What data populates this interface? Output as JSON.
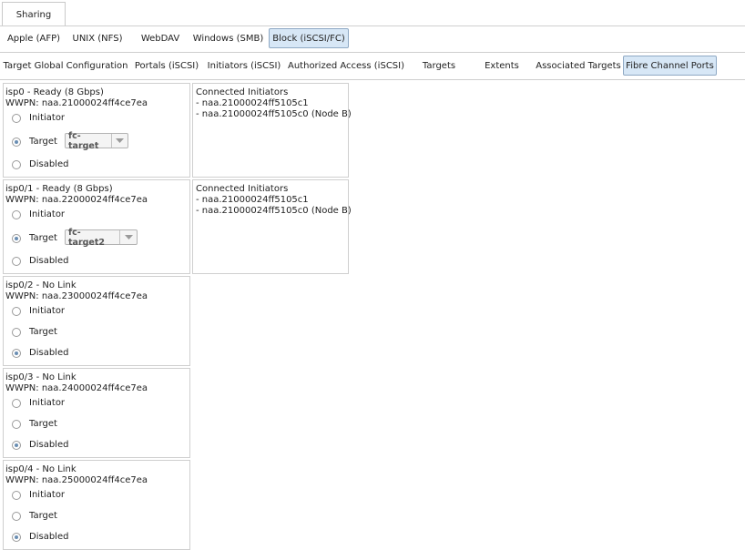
{
  "top_tab": "Sharing",
  "share_tabs": [
    "Apple (AFP)",
    "UNIX (NFS)",
    "WebDAV",
    "Windows (SMB)",
    "Block (iSCSI/FC)"
  ],
  "block_tabs": [
    "Target Global Configuration",
    "Portals (iSCSI)",
    "Initiators (iSCSI)",
    "Authorized Access (iSCSI)",
    "Targets",
    "Extents",
    "Associated Targets",
    "Fibre Channel Ports"
  ],
  "radio_labels": {
    "initiator": "Initiator",
    "target": "Target",
    "disabled": "Disabled"
  },
  "ports": [
    {
      "title": "isp0 - Ready (8 Gbps)",
      "wwpn": "WWPN: naa.21000024ff4ce7ea",
      "mode": "target",
      "target": "fc-target"
    },
    {
      "title": "isp0/1 - Ready (8 Gbps)",
      "wwpn": "WWPN: naa.22000024ff4ce7ea",
      "mode": "target",
      "target": "fc-target2"
    },
    {
      "title": "isp0/2 - No Link",
      "wwpn": "WWPN: naa.23000024ff4ce7ea",
      "mode": "disabled"
    },
    {
      "title": "isp0/3 - No Link",
      "wwpn": "WWPN: naa.24000024ff4ce7ea",
      "mode": "disabled"
    },
    {
      "title": "isp0/4 - No Link",
      "wwpn": "WWPN: naa.25000024ff4ce7ea",
      "mode": "disabled"
    }
  ],
  "connected": [
    {
      "title": "Connected Initiators",
      "items": [
        "- naa.21000024ff5105c1",
        "- naa.21000024ff5105c0 (Node B)"
      ]
    },
    {
      "title": "Connected Initiators",
      "items": [
        "- naa.21000024ff5105c1",
        "- naa.21000024ff5105c0 (Node B)"
      ]
    }
  ]
}
